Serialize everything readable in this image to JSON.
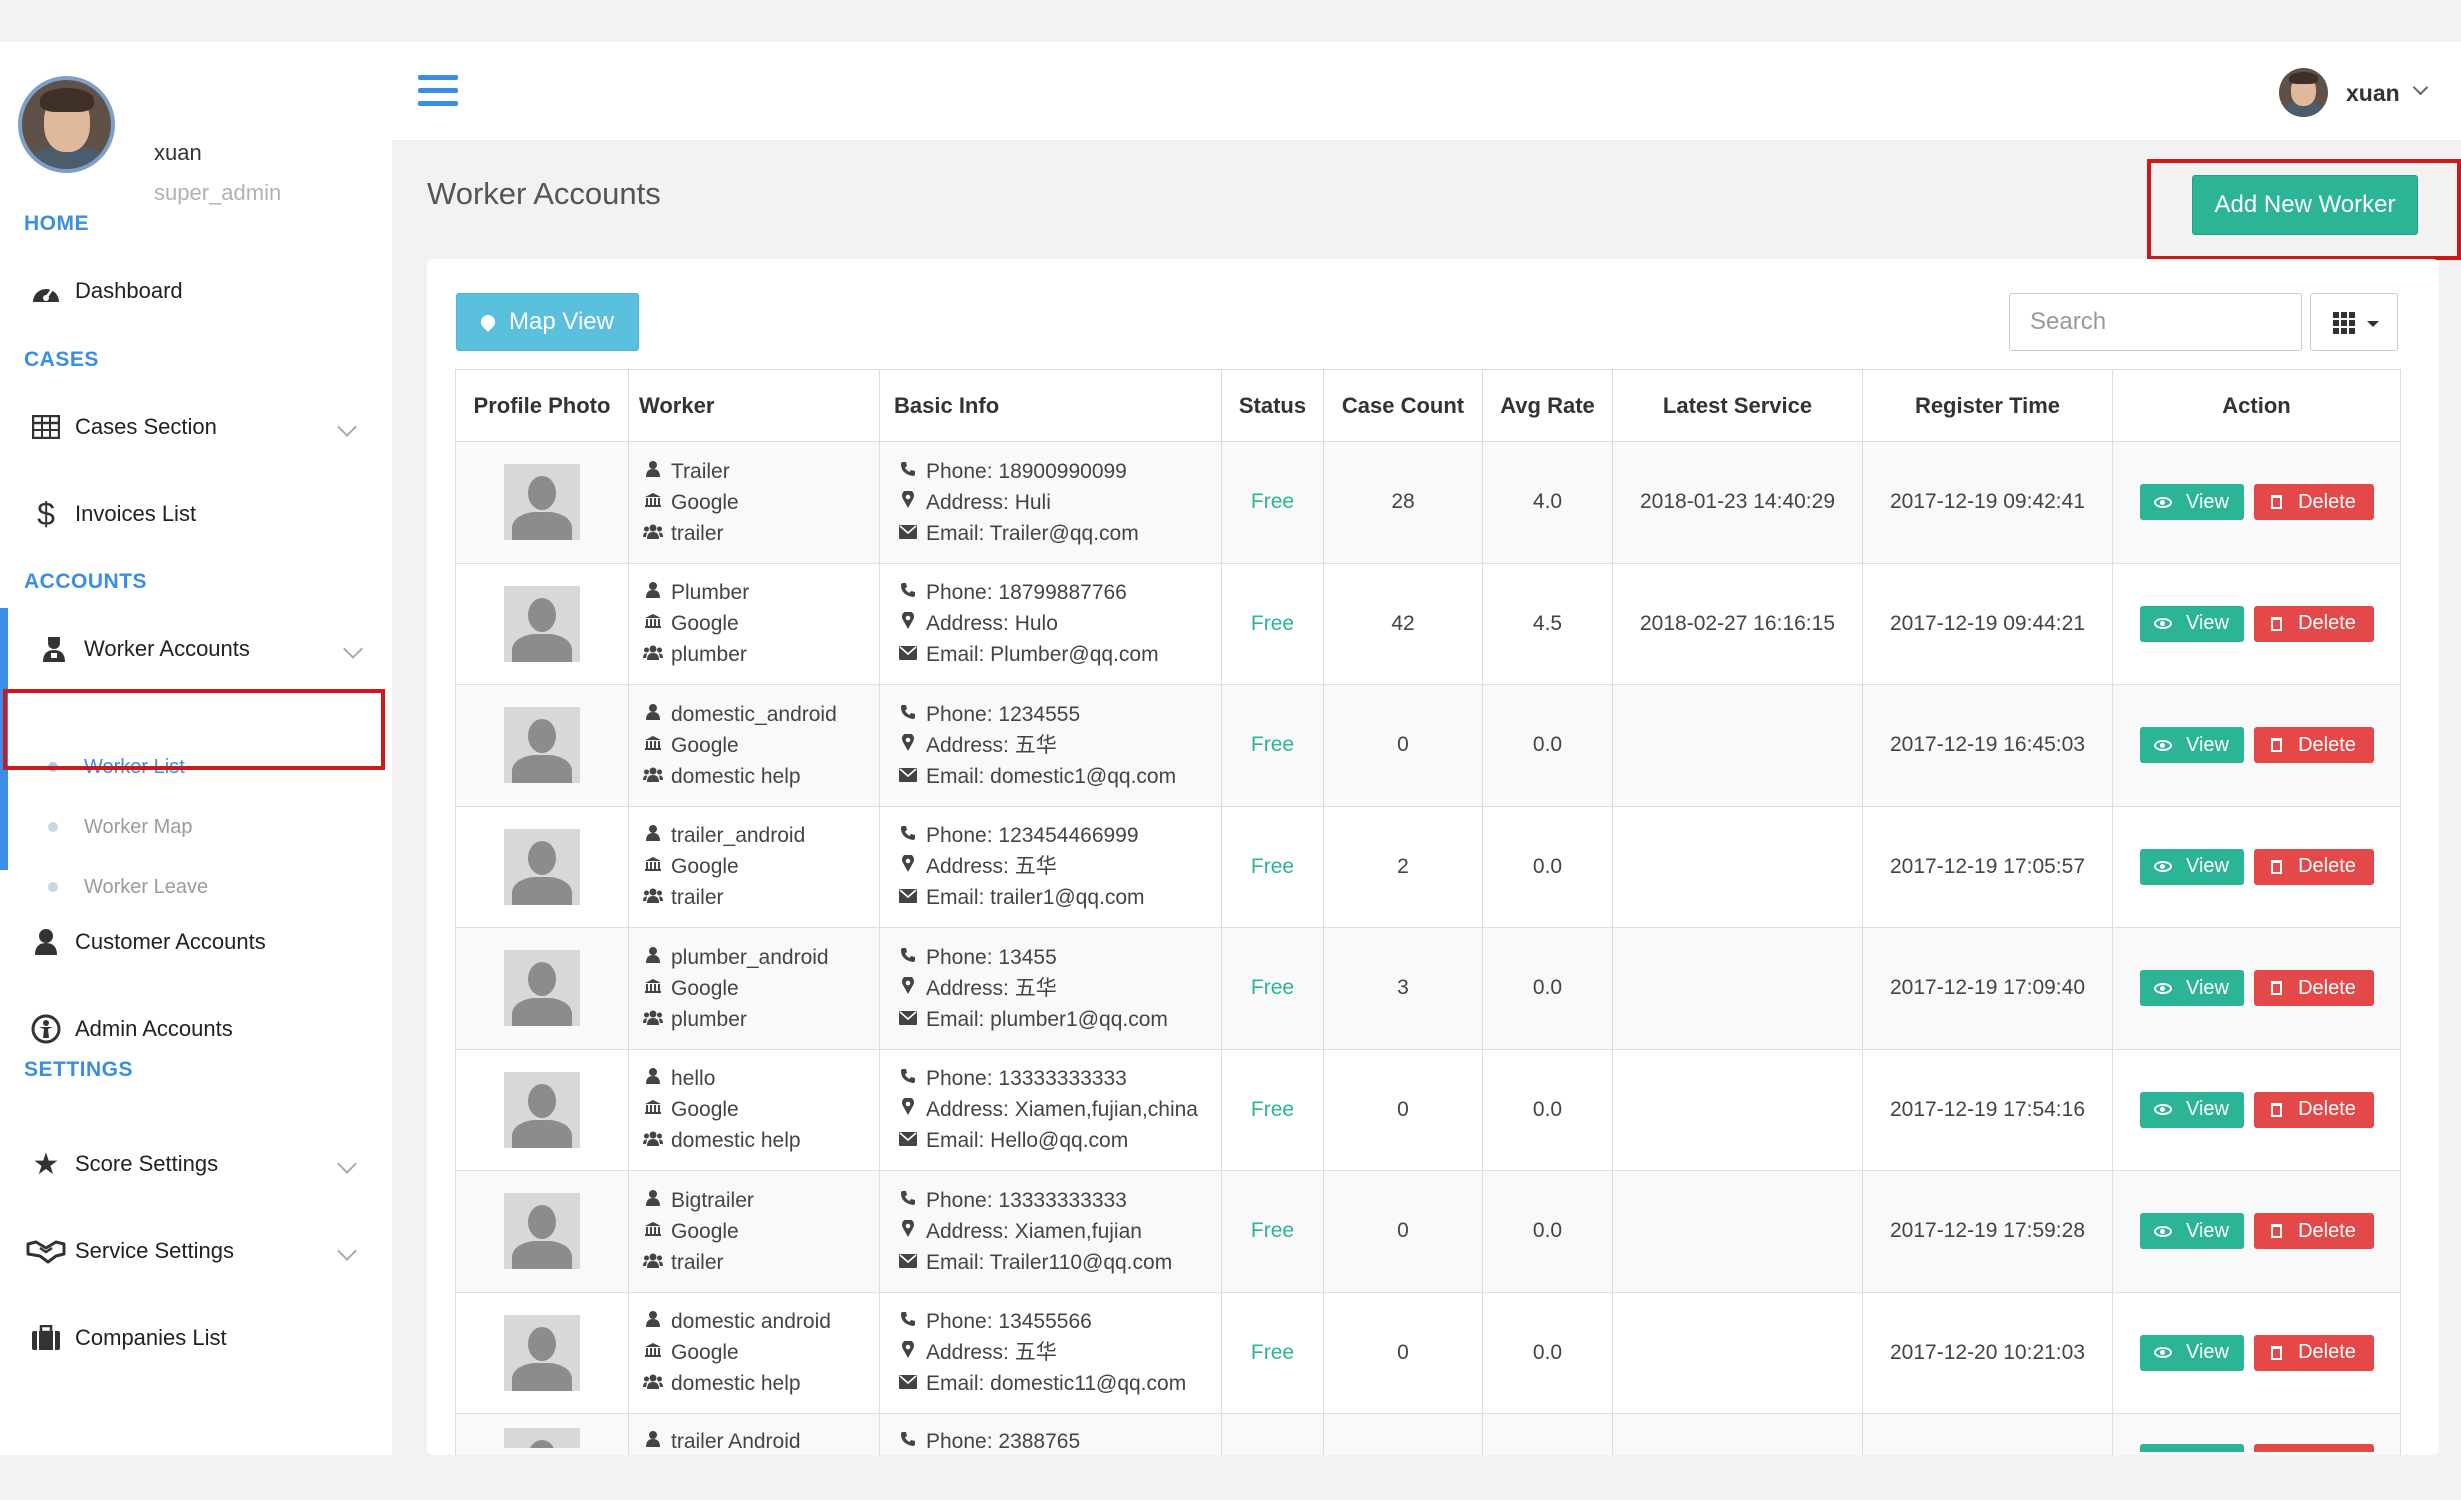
{
  "profile": {
    "name": "xuan",
    "role": "super_admin"
  },
  "nav": {
    "home_head": "HOME",
    "dashboard": "Dashboard",
    "cases_head": "CASES",
    "cases_section": "Cases Section",
    "invoices": "Invoices List",
    "accounts_head": "ACCOUNTS",
    "worker_accounts": "Worker Accounts",
    "worker_list": "Worker List",
    "worker_map": "Worker Map",
    "worker_leave": "Worker Leave",
    "customer_accounts": "Customer Accounts",
    "admin_accounts": "Admin Accounts",
    "settings_head": "SETTINGS",
    "score_settings": "Score Settings",
    "service_settings": "Service Settings",
    "companies": "Companies List"
  },
  "topbar": {
    "user_name": "xuan"
  },
  "page": {
    "title": "Worker Accounts",
    "add_button": "Add New Worker"
  },
  "toolbar": {
    "map_view": "Map View",
    "search_placeholder": "Search"
  },
  "table": {
    "headers": [
      "Profile Photo",
      "Worker",
      "Basic Info",
      "Status",
      "Case Count",
      "Avg Rate",
      "Latest Service",
      "Register Time",
      "Action"
    ],
    "view_label": "View",
    "delete_label": "Delete",
    "rows": [
      {
        "name": "Trailer",
        "company": "Google",
        "type": "trailer",
        "phone": "Phone: 18900990099",
        "address": "Address: Huli",
        "email": "Email: Trailer@qq.com",
        "status": "Free",
        "cases": "28",
        "rate": "4.0",
        "latest": "2018-01-23 14:40:29",
        "registered": "2017-12-19 09:42:41"
      },
      {
        "name": "Plumber",
        "company": "Google",
        "type": "plumber",
        "phone": "Phone: 18799887766",
        "address": "Address: Hulo",
        "email": "Email: Plumber@qq.com",
        "status": "Free",
        "cases": "42",
        "rate": "4.5",
        "latest": "2018-02-27 16:16:15",
        "registered": "2017-12-19 09:44:21"
      },
      {
        "name": "domestic_android",
        "company": "Google",
        "type": "domestic help",
        "phone": "Phone: 1234555",
        "address": "Address: 五华",
        "email": "Email: domestic1@qq.com",
        "status": "Free",
        "cases": "0",
        "rate": "0.0",
        "latest": "",
        "registered": "2017-12-19 16:45:03"
      },
      {
        "name": "trailer_android",
        "company": "Google",
        "type": "trailer",
        "phone": "Phone: 123454466999",
        "address": "Address: 五华",
        "email": "Email: trailer1@qq.com",
        "status": "Free",
        "cases": "2",
        "rate": "0.0",
        "latest": "",
        "registered": "2017-12-19 17:05:57"
      },
      {
        "name": "plumber_android",
        "company": "Google",
        "type": "plumber",
        "phone": "Phone: 13455",
        "address": "Address: 五华",
        "email": "Email: plumber1@qq.com",
        "status": "Free",
        "cases": "3",
        "rate": "0.0",
        "latest": "",
        "registered": "2017-12-19 17:09:40"
      },
      {
        "name": "hello",
        "company": "Google",
        "type": "domestic help",
        "phone": "Phone: 13333333333",
        "address": "Address: Xiamen,fujian,china",
        "email": "Email: Hello@qq.com",
        "status": "Free",
        "cases": "0",
        "rate": "0.0",
        "latest": "",
        "registered": "2017-12-19 17:54:16"
      },
      {
        "name": "Bigtrailer",
        "company": "Google",
        "type": "trailer",
        "phone": "Phone: 13333333333",
        "address": "Address: Xiamen,fujian",
        "email": "Email: Trailer110@qq.com",
        "status": "Free",
        "cases": "0",
        "rate": "0.0",
        "latest": "",
        "registered": "2017-12-19 17:59:28"
      },
      {
        "name": "domestic android",
        "company": "Google",
        "type": "domestic help",
        "phone": "Phone: 13455566",
        "address": "Address: 五华",
        "email": "Email: domestic11@qq.com",
        "status": "Free",
        "cases": "0",
        "rate": "0.0",
        "latest": "",
        "registered": "2017-12-20 10:21:03"
      }
    ],
    "partial_row": {
      "name": "trailer Android",
      "phone": "Phone: 2388765"
    }
  },
  "colors": {
    "accent": "#3a8ee6",
    "success": "#2bb596",
    "danger": "#e54848",
    "info": "#5bc0de",
    "highlight": "#d0171b"
  },
  "icons": [
    "hamburger-icon",
    "dashboard-icon",
    "table-icon",
    "dollar-icon",
    "worker-icon",
    "user-icon",
    "admin-icon",
    "star-icon",
    "handshake-icon",
    "briefcase-icon",
    "map-pin-icon",
    "grid-icon",
    "phone-icon",
    "map-marker-icon",
    "envelope-icon",
    "eye-icon",
    "trash-icon"
  ]
}
